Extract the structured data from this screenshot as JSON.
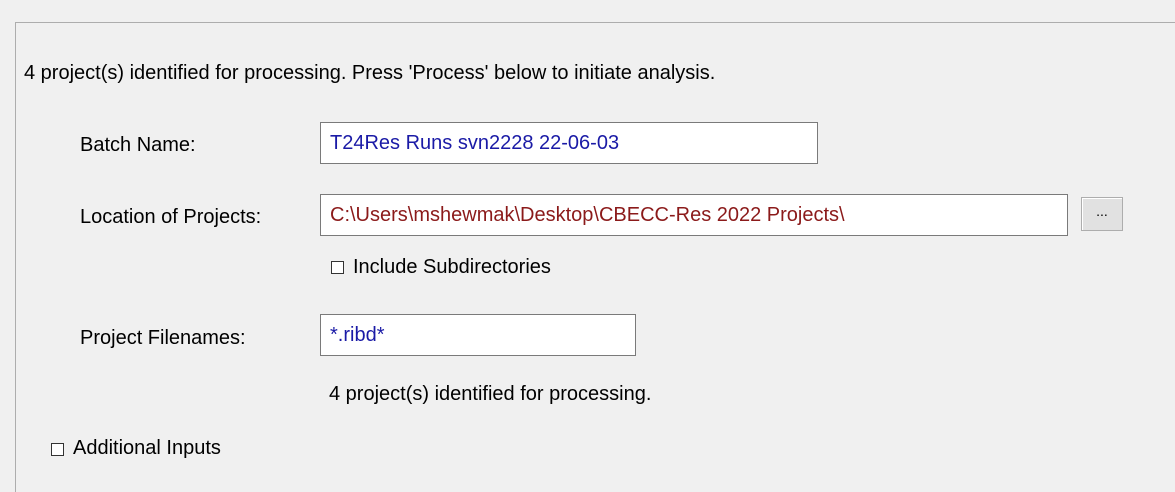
{
  "header_text": "4 project(s) identified for processing.  Press 'Process' below to initiate analysis.",
  "batch_name": {
    "label": "Batch Name:",
    "value": "T24Res Runs svn2228 22-06-03"
  },
  "location": {
    "label": "Location of Projects:",
    "value": "C:\\Users\\mshewmak\\Desktop\\CBECC-Res 2022 Projects\\",
    "browse_label": "..."
  },
  "include_subdirectories": {
    "label": "Include Subdirectories",
    "checked": false
  },
  "project_filenames": {
    "label": "Project Filenames:",
    "value": "*.ribd*"
  },
  "identified_text": "4 project(s) identified for processing.",
  "additional_inputs": {
    "label": "Additional Inputs",
    "checked": false
  },
  "colors": {
    "background": "#f0f0f0",
    "input_blue_text": "#1a1aa6",
    "input_red_text": "#8b1a1a"
  }
}
